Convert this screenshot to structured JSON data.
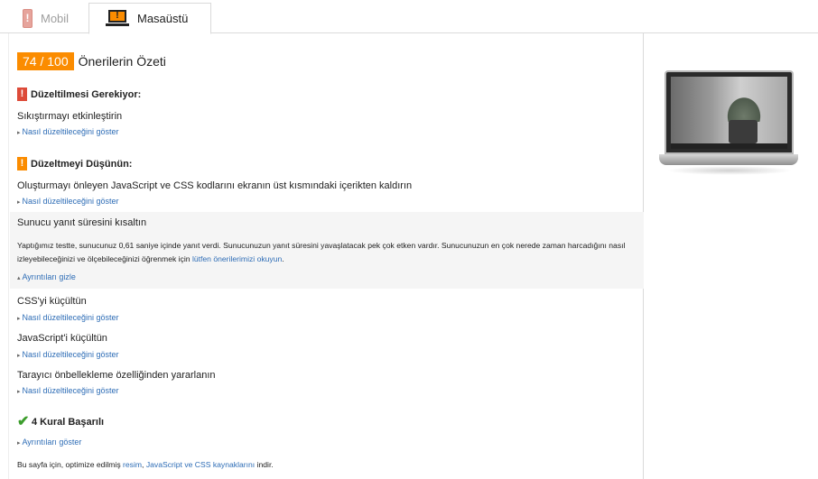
{
  "tabs": [
    {
      "label": "Mobil"
    },
    {
      "label": "Masaüstü"
    }
  ],
  "summary": {
    "score": "74 / 100",
    "title": "Önerilerin Özeti"
  },
  "sections": {
    "must_fix": {
      "title": "Düzeltilmesi Gerekiyor:",
      "rules": [
        {
          "title": "Sıkıştırmayı etkinleştirin",
          "link": "Nasıl düzeltileceğini göster"
        }
      ]
    },
    "consider_fix": {
      "title": "Düzeltmeyi Düşünün:",
      "rules": [
        {
          "title": "Oluşturmayı önleyen JavaScript ve CSS kodlarını ekranın üst kısmındaki içerikten kaldırın",
          "link": "Nasıl düzeltileceğini göster"
        },
        {
          "title": "Sunucu yanıt süresini kısaltın",
          "detail": "Yaptığımız testte, sunucunuz 0,61 saniye içinde yanıt verdi. Sunucunuzun yanıt süresini yavaşlatacak pek çok etken vardır. Sunucunuzun en çok nerede zaman harcadığını nasıl izleyebileceğinizi ve ölçebileceğinizi öğrenmek için",
          "detail_link": "lütfen önerilerimizi okuyun",
          "detail_end": ".",
          "link": "Ayrıntıları gizle"
        },
        {
          "title": "CSS'yi küçültün",
          "link": "Nasıl düzeltileceğini göster"
        },
        {
          "title": "JavaScript'i küçültün",
          "link": "Nasıl düzeltileceğini göster"
        },
        {
          "title": "Tarayıcı önbellekleme özelliğinden yararlanın",
          "link": "Nasıl düzeltileceğini göster"
        }
      ]
    },
    "passed": {
      "title": "4 Kural Başarılı",
      "link": "Ayrıntıları göster"
    }
  },
  "footer": {
    "prefix": "Bu sayfa için, optimize edilmiş",
    "link1": "resim",
    "sep": ",",
    "link2": "JavaScript ve CSS kaynaklarını",
    "suffix": "indir."
  },
  "colors": {
    "score_bg": "#fb8c00",
    "error": "#dd4b39",
    "warning": "#fb8c00",
    "success": "#3c9d2c",
    "link": "#2e6db6"
  },
  "icons": {
    "mobile_tab": "phone-warning-icon",
    "desktop_tab": "laptop-warning-icon",
    "must_fix": "exclamation-icon",
    "consider_fix": "exclamation-icon",
    "passed": "checkmark-icon"
  }
}
